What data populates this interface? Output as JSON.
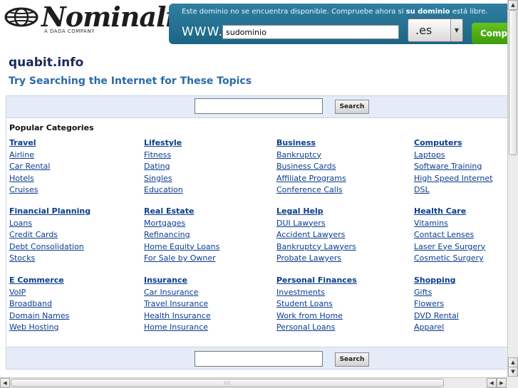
{
  "logo": {
    "brand": "Nominalia",
    "tagline": "A DADA COMPANY"
  },
  "banner": {
    "message_prefix": "Este dominio no se encuentra disponible. Compruebe ahora si ",
    "message_bold": "su dominio",
    "message_suffix": " está libre.",
    "www_label": "WWW.",
    "domain_value": "sudominio",
    "tld_selected": ".es",
    "buy_label": "Compr"
  },
  "page": {
    "site_title": "quabit.info",
    "subtitle": "Try Searching the Internet for These Topics",
    "search_button": "Search",
    "popular_label": "Popular Categories"
  },
  "categories": [
    [
      {
        "title": "Travel",
        "links": [
          "Airline",
          "Car Rental",
          "Hotels",
          "Cruises"
        ]
      },
      {
        "title": "Lifestyle",
        "links": [
          "Fitness",
          "Dating",
          "Singles",
          "Education"
        ]
      },
      {
        "title": "Business",
        "links": [
          "Bankruptcy",
          "Business Cards",
          "Affiliate Programs",
          "Conference Calls"
        ]
      },
      {
        "title": "Computers",
        "links": [
          "Laptops",
          "Software Training",
          "High Speed Internet",
          "DSL"
        ]
      }
    ],
    [
      {
        "title": "Financial Planning",
        "links": [
          "Loans",
          "Credit Cards",
          "Debt Consolidation",
          "Stocks"
        ]
      },
      {
        "title": "Real Estate",
        "links": [
          "Mortgages",
          "Refinancing",
          "Home Equity Loans",
          "For Sale by Owner"
        ]
      },
      {
        "title": "Legal Help",
        "links": [
          "DUI Lawyers",
          "Accident Lawyers",
          "Bankruptcy Lawyers",
          "Probate Lawyers"
        ]
      },
      {
        "title": "Health Care",
        "links": [
          "Vitamins",
          "Contact Lenses",
          "Laser Eye Surgery",
          "Cosmetic Surgery"
        ]
      }
    ],
    [
      {
        "title": "E Commerce",
        "links": [
          "VoIP",
          "Broadband",
          "Domain Names",
          "Web Hosting"
        ]
      },
      {
        "title": "Insurance",
        "links": [
          "Car Insurance",
          "Travel Insurance",
          "Health Insurance",
          "Home Insurance"
        ]
      },
      {
        "title": "Personal Finances",
        "links": [
          "Investments",
          "Student Loans",
          "Work from Home",
          "Personal Loans"
        ]
      },
      {
        "title": "Shopping",
        "links": [
          "Gifts",
          "Flowers",
          "DVD Rental",
          "Apparel"
        ]
      }
    ]
  ],
  "icons": {
    "logo": "globe-icon",
    "tld_dropdown": "chevron-down-icon",
    "scroll_up": "arrow-up-icon",
    "scroll_down": "arrow-down-icon",
    "scroll_left": "arrow-left-icon",
    "scroll_right": "arrow-right-icon"
  },
  "colors": {
    "link": "#0a3d8f",
    "banner": "#1c6584",
    "buy_button": "#4aa812",
    "search_band": "#e4ecf8"
  }
}
